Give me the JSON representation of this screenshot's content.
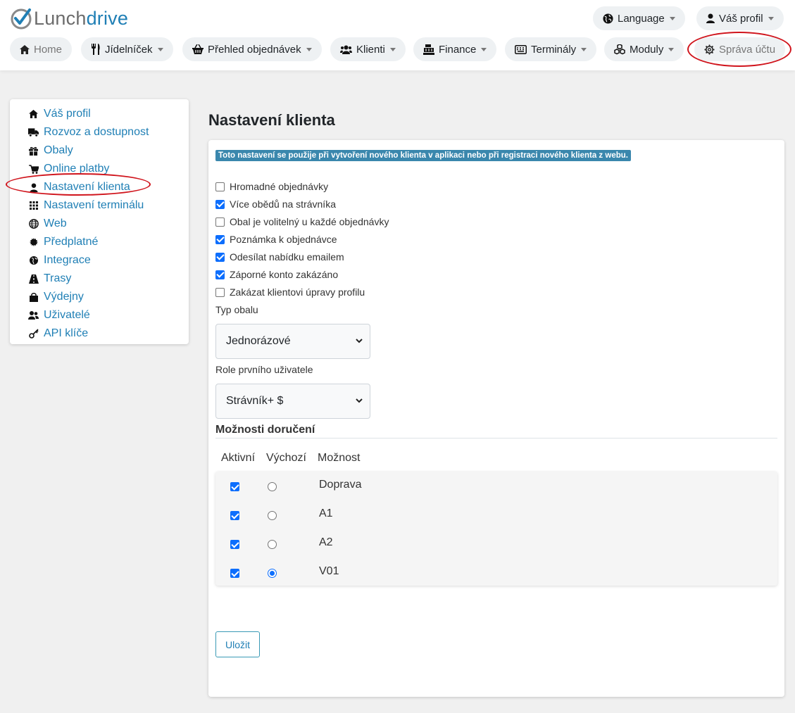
{
  "app": {
    "logo_part1": "Lunch",
    "logo_part2": "drive",
    "brand_color": "#1f7fb5",
    "accent_color": "#d0141c"
  },
  "header": {
    "language": "Language",
    "profile": "Váš profil",
    "nav": [
      {
        "label": "Home",
        "icon": "home-icon"
      },
      {
        "label": "Jídelníček",
        "icon": "utensils-icon"
      },
      {
        "label": "Přehled objednávek",
        "icon": "basket-icon"
      },
      {
        "label": "Klienti",
        "icon": "users-icon"
      },
      {
        "label": "Finance",
        "icon": "cash-register-icon"
      },
      {
        "label": "Terminály",
        "icon": "keyboard-icon"
      },
      {
        "label": "Moduly",
        "icon": "cubes-icon"
      },
      {
        "label": "Správa účtu",
        "icon": "gear-icon"
      }
    ]
  },
  "sidebar": {
    "items": [
      {
        "label": "Váš profil",
        "icon": "home-icon"
      },
      {
        "label": "Rozvoz a dostupnost",
        "icon": "truck-icon"
      },
      {
        "label": "Obaly",
        "icon": "gift-icon"
      },
      {
        "label": "Online platby",
        "icon": "cart-icon"
      },
      {
        "label": "Nastavení klienta",
        "icon": "user-icon"
      },
      {
        "label": "Nastavení terminálu",
        "icon": "grid-icon"
      },
      {
        "label": "Web",
        "icon": "globe-icon"
      },
      {
        "label": "Předplatné",
        "icon": "certificate-icon"
      },
      {
        "label": "Integrace",
        "icon": "globe-africa-icon"
      },
      {
        "label": "Trasy",
        "icon": "road-icon"
      },
      {
        "label": "Výdejny",
        "icon": "bag-icon"
      },
      {
        "label": "Uživatelé",
        "icon": "users-icon"
      },
      {
        "label": "API klíče",
        "icon": "key-icon"
      }
    ]
  },
  "main": {
    "title": "Nastavení klienta",
    "info": "Toto nastavení se použije při vytvoření nového klienta v aplikaci nebo při registraci nového klienta z webu.",
    "checkboxes": [
      {
        "label": "Hromadné objednávky",
        "checked": false
      },
      {
        "label": "Více obědů na strávníka",
        "checked": true
      },
      {
        "label": "Obal je volitelný u každé objednávky",
        "checked": false
      },
      {
        "label": "Poznámka k objednávce",
        "checked": true
      },
      {
        "label": "Odesílat nabídku emailem",
        "checked": true
      },
      {
        "label": "Záporné konto zakázáno",
        "checked": true
      },
      {
        "label": "Zakázat klientovi úpravy profilu",
        "checked": false
      }
    ],
    "package_type": {
      "label": "Typ obalu",
      "value": "Jednorázové"
    },
    "first_user_role": {
      "label": "Role prvního uživatele",
      "value": "Strávník+ $"
    },
    "delivery": {
      "title": "Možnosti doručení",
      "headers": [
        "Aktivní",
        "Výchozí",
        "Možnost"
      ],
      "options": [
        {
          "label": "Doprava",
          "active": true,
          "default": false
        },
        {
          "label": "A1",
          "active": true,
          "default": false
        },
        {
          "label": "A2",
          "active": true,
          "default": false
        },
        {
          "label": "V01",
          "active": true,
          "default": true
        }
      ]
    },
    "save": "Uložit"
  }
}
